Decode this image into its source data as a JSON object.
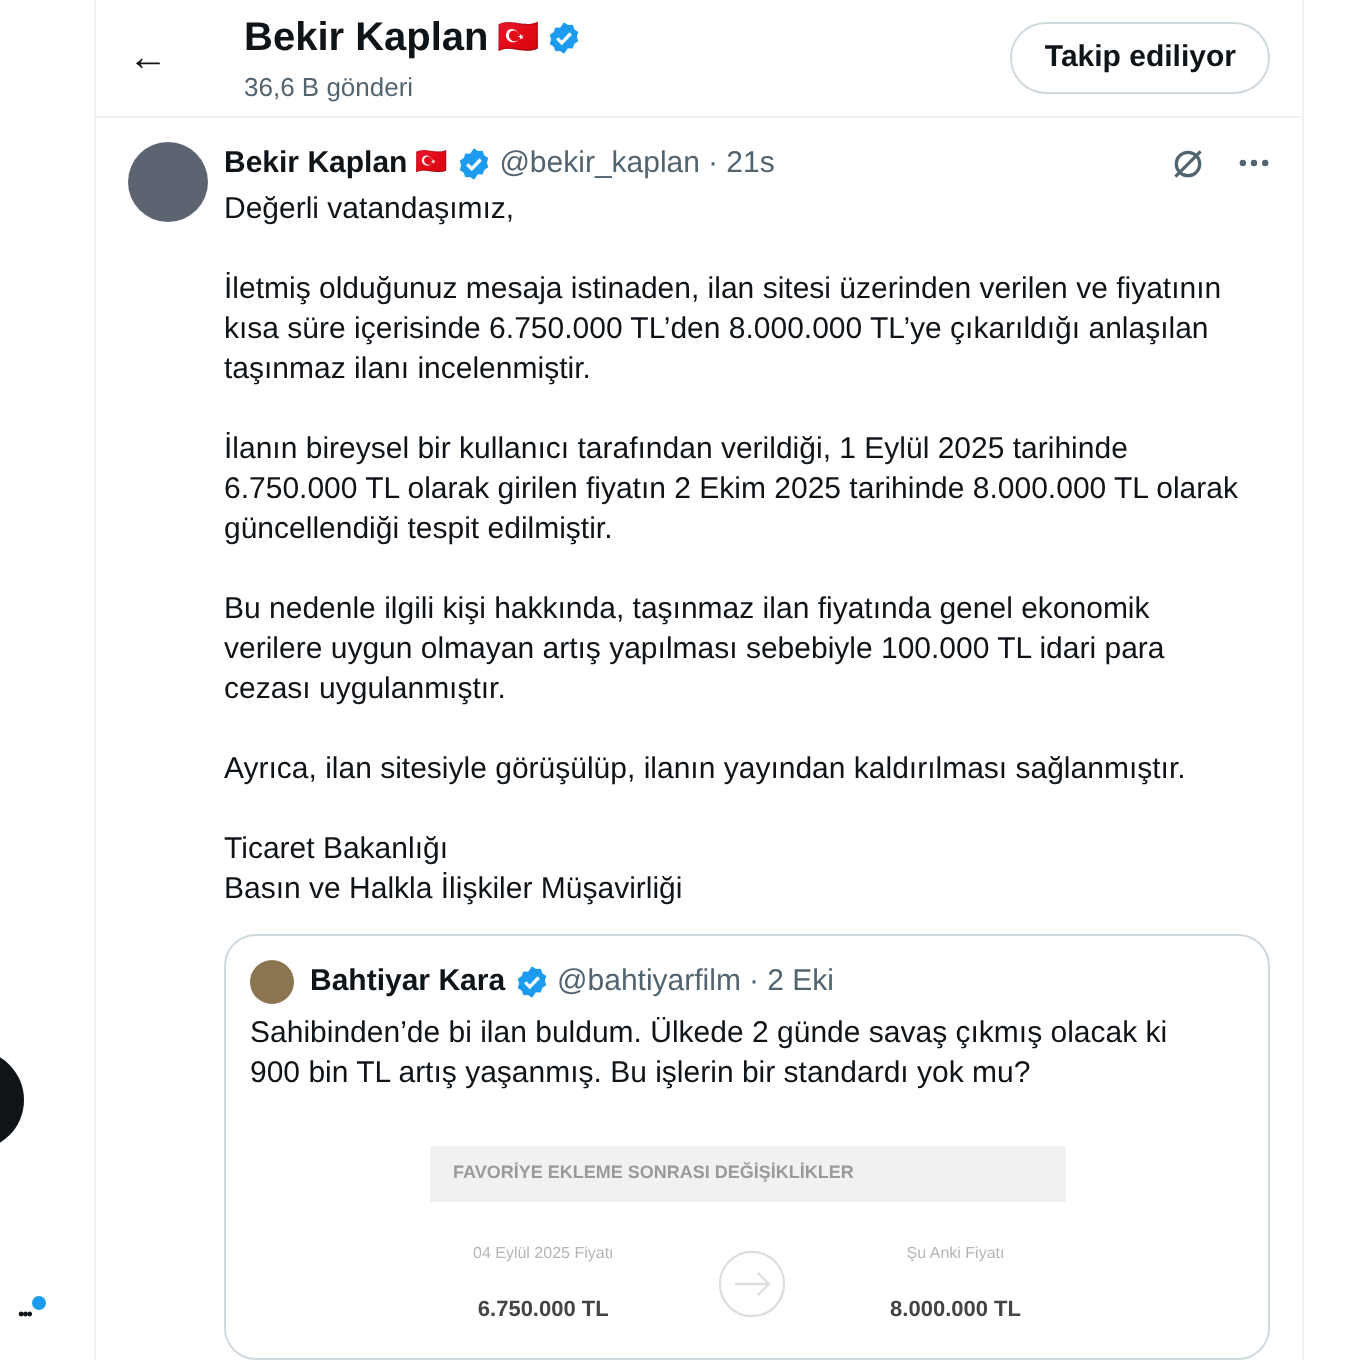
{
  "header": {
    "back": "←",
    "name": "Bekir Kaplan",
    "flag": "🇹🇷",
    "posts": "36,6 B gönderi",
    "follow_button": "Takip ediliyor",
    "verified": true
  },
  "sidebar": {
    "more": "•••",
    "notification_dot": true
  },
  "post": {
    "name": "Bekir Kaplan",
    "handle": "@bekir_kaplan",
    "time": "· 21s",
    "verified": true,
    "paragraphs": [
      "Değerli vatandaşımız,",
      "İletmiş olduğunuz mesaja istinaden, ilan sitesi üzerinden verilen ve fiyatının kısa süre içerisinde 6.750.000 TL’den 8.000.000 TL’ye çıkarıldığı anlaşılan taşınmaz ilanı incelenmiştir.",
      "İlanın bireysel bir kullanıcı tarafından verildiği, 1 Eylül 2025 tarihinde 6.750.000 TL olarak girilen fiyatın 2 Ekim 2025 tarihinde 8.000.000 TL olarak güncellendiği tespit edilmiştir.",
      "Bu nedenle ilgili kişi hakkında, taşınmaz ilan fiyatında genel ekonomik verilere uygun olmayan artış yapılması sebebiyle 100.000 TL idari para cezası uygulanmıştır.",
      "Ayrıca, ilan sitesiyle görüşülüp, ilanın yayından kaldırılması sağlanmıştır.",
      "Ticaret Bakanlığı\nBasın ve Halkla İlişkiler Müşavirliği"
    ],
    "quote": {
      "name": "Bahtiyar Kara",
      "handle": "@bahtiyarfilm",
      "time": "· 2 Eki",
      "verified": true,
      "text": "Sahibinden’de bi ilan buldum. Ülkede 2 günde savaş çıkmış olacak ki 900 bin TL artış yaşanmış. Bu işlerin bir standardı yok mu?",
      "image": {
        "heading": "FAVORİYE EKLEME SONRASI DEĞİŞİKLİKLER",
        "old_label": "04 Eylül 2025 Fiyatı",
        "old_price": "6.750.000 TL",
        "new_label": "Şu Anki Fiyatı",
        "new_price": "8.000.000 TL"
      }
    }
  }
}
